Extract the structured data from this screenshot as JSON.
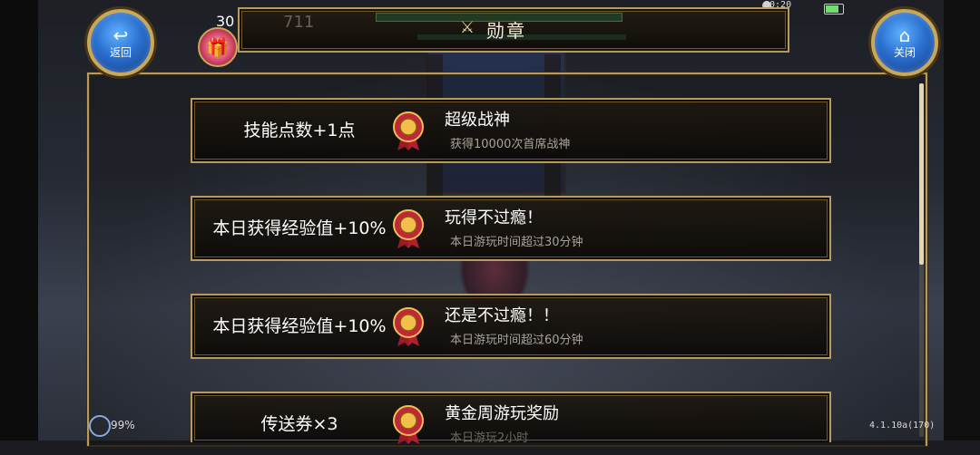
{
  "status": {
    "time": "00:20",
    "battery": "99%",
    "version": "4.1.10a(170)"
  },
  "hud": {
    "coins": "30",
    "ghost_number": "711"
  },
  "header": {
    "title": "勋章",
    "title_icon": "crossed-swords-icon"
  },
  "buttons": {
    "back_label": "返回",
    "close_label": "关闭"
  },
  "medals": [
    {
      "reward": "技能点数+1点",
      "name": "超级战神",
      "desc": "获得10000次首席战神"
    },
    {
      "reward": "本日获得经验值+10%",
      "name": "玩得不过瘾！",
      "desc": "本日游玩时间超过30分钟"
    },
    {
      "reward": "本日获得经验值+10%",
      "name": "还是不过瘾！！",
      "desc": "本日游玩时间超过60分钟"
    },
    {
      "reward": "传送券×3",
      "name": "黄金周游玩奖励",
      "desc": "本日游玩2小时"
    }
  ],
  "colors": {
    "frame_gold": "#b89a5e",
    "button_blue": "#2a6fd0",
    "medal_red": "#c0283a"
  }
}
